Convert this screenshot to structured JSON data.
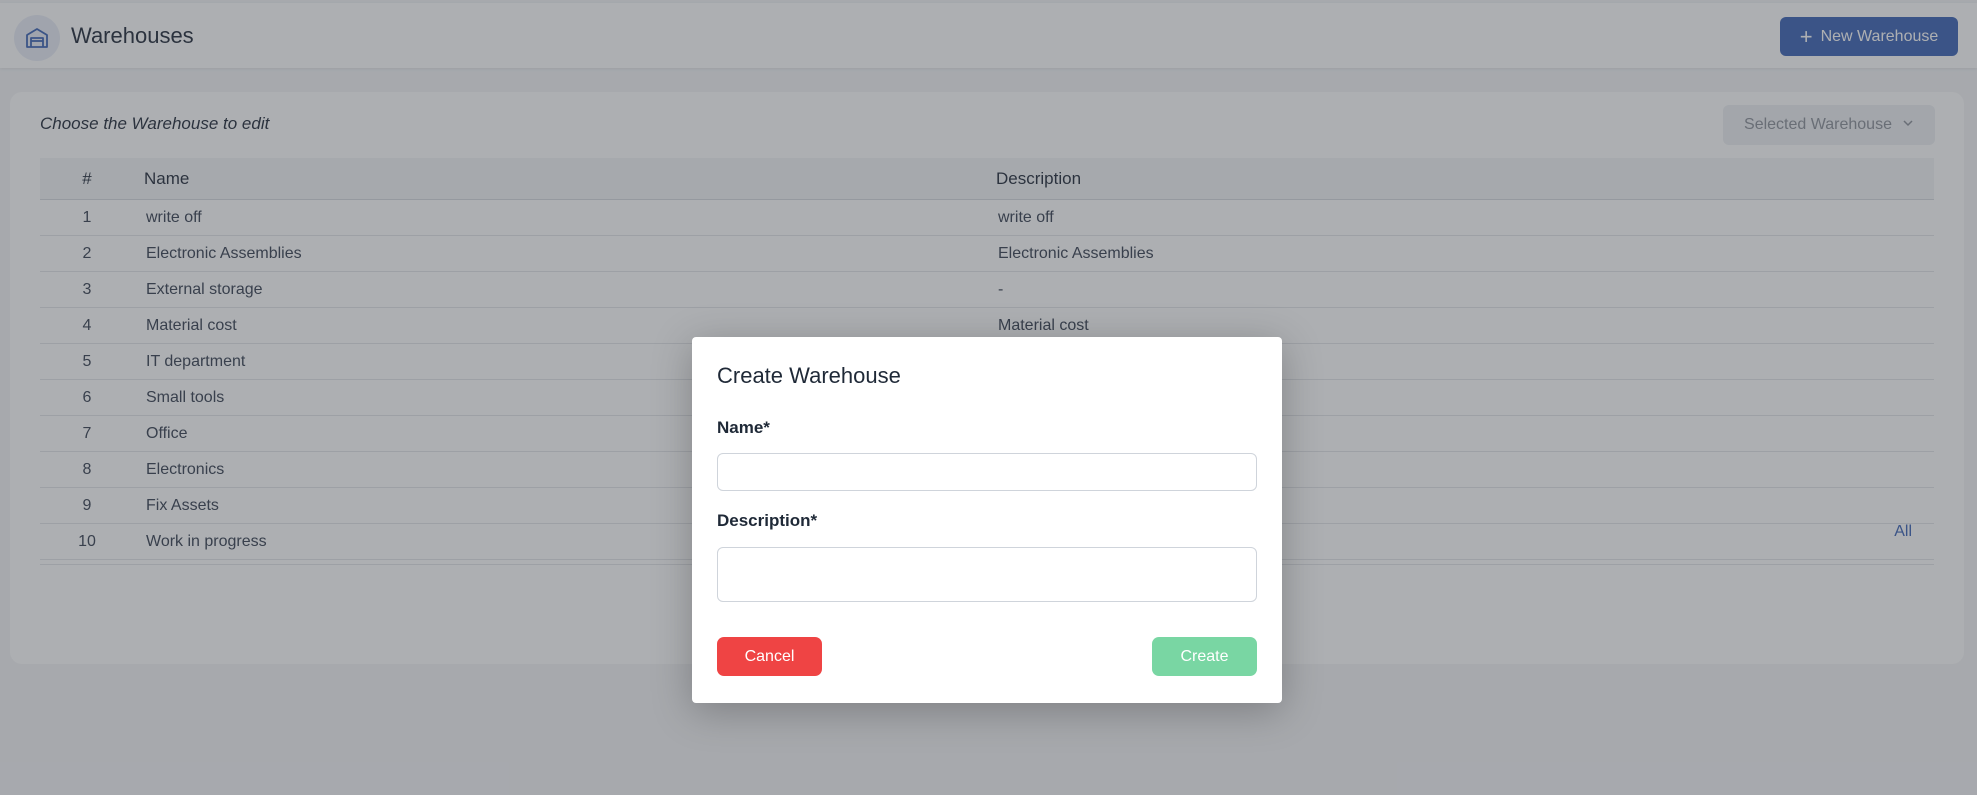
{
  "header": {
    "icon": "warehouse-icon",
    "title": "Warehouses",
    "new_button_label": "New Warehouse"
  },
  "card": {
    "heading": "Choose the Warehouse to edit",
    "selected_warehouse_label": "Selected Warehouse"
  },
  "table": {
    "columns": [
      "#",
      "Name",
      "Description"
    ],
    "rows": [
      {
        "num": "1",
        "name": "write off",
        "description": "write off"
      },
      {
        "num": "2",
        "name": "Electronic Assemblies",
        "description": "Electronic Assemblies"
      },
      {
        "num": "3",
        "name": "External storage",
        "description": "-"
      },
      {
        "num": "4",
        "name": "Material cost",
        "description": "Material cost"
      },
      {
        "num": "5",
        "name": "IT department",
        "description": ""
      },
      {
        "num": "6",
        "name": "Small tools",
        "description": ""
      },
      {
        "num": "7",
        "name": "Office",
        "description": ""
      },
      {
        "num": "8",
        "name": "Electronics",
        "description": ""
      },
      {
        "num": "9",
        "name": "Fix Assets",
        "description": ""
      },
      {
        "num": "10",
        "name": "Work in progress",
        "description": ""
      }
    ],
    "footer_link": "All"
  },
  "modal": {
    "title": "Create Warehouse",
    "name_label": "Name*",
    "name_value": "",
    "description_label": "Description*",
    "description_value": "",
    "cancel_label": "Cancel",
    "create_label": "Create"
  },
  "colors": {
    "primary": "#3b63b5",
    "danger": "#ef4444",
    "success_disabled": "#79d6a3"
  }
}
